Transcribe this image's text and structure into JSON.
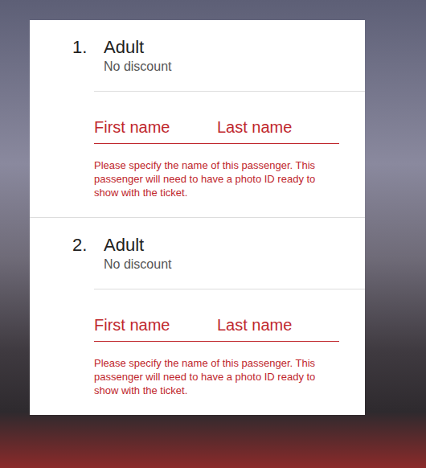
{
  "passengers": [
    {
      "number": "1.",
      "type": "Adult",
      "discount": "No discount",
      "fields": [
        {
          "placeholder": "First name"
        },
        {
          "placeholder": "Last name"
        }
      ],
      "message": "Please specify the name of this passenger. This passenger will need to have a photo ID ready to show with the ticket."
    },
    {
      "number": "2.",
      "type": "Adult",
      "discount": "No discount",
      "fields": [
        {
          "placeholder": "First name"
        },
        {
          "placeholder": "Last name"
        }
      ],
      "message": "Please specify the name of this passenger. This passenger will need to have a photo ID ready to show with the ticket."
    }
  ]
}
